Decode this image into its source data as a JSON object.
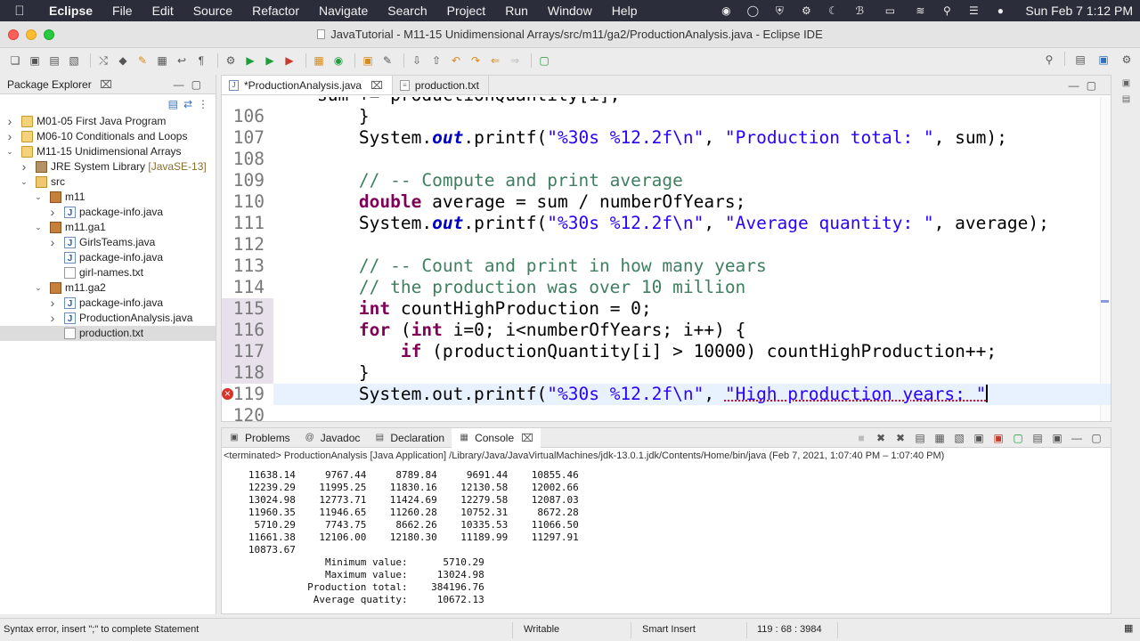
{
  "menubar": {
    "app_name": "Eclipse",
    "items": [
      "File",
      "Edit",
      "Source",
      "Refactor",
      "Navigate",
      "Search",
      "Project",
      "Run",
      "Window",
      "Help"
    ],
    "clock": "Sun Feb 7  1:12 PM",
    "tray_icons": [
      "record-icon",
      "eclipse-icon",
      "shield-icon",
      "settings-icon",
      "moon-icon",
      "bluetooth-icon",
      "battery-icon",
      "wifi-icon",
      "search-icon",
      "control-center-icon",
      "user-icon"
    ]
  },
  "window": {
    "title": "JavaTutorial - M11-15 Unidimensional Arrays/src/m11/ga2/ProductionAnalysis.java - Eclipse IDE"
  },
  "package_explorer": {
    "title": "Package Explorer",
    "tree": [
      {
        "label": "M01-05 First Java Program",
        "deco": "",
        "icon": "project",
        "arrow": ">",
        "depth": 0,
        "selected": false
      },
      {
        "label": "M06-10 Conditionals and Loops",
        "deco": "",
        "icon": "project",
        "arrow": ">",
        "depth": 0,
        "selected": false
      },
      {
        "label": "M11-15 Unidimensional Arrays",
        "deco": "",
        "icon": "project",
        "arrow": "v",
        "depth": 0,
        "selected": false
      },
      {
        "label": "JRE System Library ",
        "deco": "[JavaSE-13]",
        "icon": "library",
        "arrow": ">",
        "depth": 1,
        "selected": false
      },
      {
        "label": "src",
        "deco": "",
        "icon": "folder",
        "arrow": "v",
        "depth": 1,
        "selected": false
      },
      {
        "label": "m11",
        "deco": "",
        "icon": "package",
        "arrow": "v",
        "depth": 2,
        "selected": false
      },
      {
        "label": "package-info.java",
        "deco": "",
        "icon": "java",
        "arrow": ">",
        "depth": 3,
        "selected": false
      },
      {
        "label": "m11.ga1",
        "deco": "",
        "icon": "package",
        "arrow": "v",
        "depth": 2,
        "selected": false
      },
      {
        "label": "GirlsTeams.java",
        "deco": "",
        "icon": "java",
        "arrow": ">",
        "depth": 3,
        "selected": false
      },
      {
        "label": "package-info.java",
        "deco": "",
        "icon": "java",
        "arrow": "",
        "depth": 3,
        "selected": false
      },
      {
        "label": "girl-names.txt",
        "deco": "",
        "icon": "txt",
        "arrow": "",
        "depth": 3,
        "selected": false
      },
      {
        "label": "m11.ga2",
        "deco": "",
        "icon": "package",
        "arrow": "v",
        "depth": 2,
        "selected": false
      },
      {
        "label": "package-info.java",
        "deco": "",
        "icon": "java",
        "arrow": ">",
        "depth": 3,
        "selected": false
      },
      {
        "label": "ProductionAnalysis.java",
        "deco": "",
        "icon": "java",
        "arrow": ">",
        "depth": 3,
        "selected": false
      },
      {
        "label": "production.txt",
        "deco": "",
        "icon": "txt",
        "arrow": "",
        "depth": 3,
        "selected": true
      }
    ]
  },
  "editor": {
    "tabs": [
      {
        "label": "*ProductionAnalysis.java",
        "active": true
      },
      {
        "label": "production.txt",
        "active": false
      }
    ],
    "partial_top_line": "    sum += productionQuantity[i];",
    "lines": [
      {
        "num": "106",
        "hl": false,
        "err": false,
        "cur": false,
        "code": [
          {
            "t": "        }",
            "c": ""
          }
        ]
      },
      {
        "num": "107",
        "hl": false,
        "err": false,
        "cur": false,
        "code": [
          {
            "t": "        System.",
            "c": ""
          },
          {
            "t": "out",
            "c": "fld"
          },
          {
            "t": ".printf(",
            "c": ""
          },
          {
            "t": "\"%30s %12.2f\\n\"",
            "c": "str"
          },
          {
            "t": ", ",
            "c": ""
          },
          {
            "t": "\"Production total: \"",
            "c": "str"
          },
          {
            "t": ", sum);",
            "c": ""
          }
        ]
      },
      {
        "num": "108",
        "hl": false,
        "err": false,
        "cur": false,
        "code": []
      },
      {
        "num": "109",
        "hl": false,
        "err": false,
        "cur": false,
        "code": [
          {
            "t": "        // -- Compute and print average",
            "c": "cm"
          }
        ]
      },
      {
        "num": "110",
        "hl": false,
        "err": false,
        "cur": false,
        "code": [
          {
            "t": "        ",
            "c": ""
          },
          {
            "t": "double",
            "c": "kw"
          },
          {
            "t": " average = sum / numberOfYears;",
            "c": ""
          }
        ]
      },
      {
        "num": "111",
        "hl": false,
        "err": false,
        "cur": false,
        "code": [
          {
            "t": "        System.",
            "c": ""
          },
          {
            "t": "out",
            "c": "fld"
          },
          {
            "t": ".printf(",
            "c": ""
          },
          {
            "t": "\"%30s %12.2f\\n\"",
            "c": "str"
          },
          {
            "t": ", ",
            "c": ""
          },
          {
            "t": "\"Average quantity: \"",
            "c": "str"
          },
          {
            "t": ", average);",
            "c": ""
          }
        ]
      },
      {
        "num": "112",
        "hl": false,
        "err": false,
        "cur": false,
        "code": []
      },
      {
        "num": "113",
        "hl": false,
        "err": false,
        "cur": false,
        "code": [
          {
            "t": "        // -- Count and print in how many years",
            "c": "cm"
          }
        ]
      },
      {
        "num": "114",
        "hl": false,
        "err": false,
        "cur": false,
        "code": [
          {
            "t": "        // the production was over 10 million",
            "c": "cm"
          }
        ]
      },
      {
        "num": "115",
        "hl": true,
        "err": false,
        "cur": false,
        "code": [
          {
            "t": "        ",
            "c": ""
          },
          {
            "t": "int",
            "c": "kw"
          },
          {
            "t": " countHighProduction = 0;",
            "c": ""
          }
        ]
      },
      {
        "num": "116",
        "hl": true,
        "err": false,
        "cur": false,
        "code": [
          {
            "t": "        ",
            "c": ""
          },
          {
            "t": "for",
            "c": "kw"
          },
          {
            "t": " (",
            "c": ""
          },
          {
            "t": "int",
            "c": "kw"
          },
          {
            "t": " i=0; i<numberOfYears; i++) {",
            "c": ""
          }
        ]
      },
      {
        "num": "117",
        "hl": true,
        "err": false,
        "cur": false,
        "code": [
          {
            "t": "            ",
            "c": ""
          },
          {
            "t": "if",
            "c": "kw"
          },
          {
            "t": " (productionQuantity[i] > 10000) countHighProduction++;",
            "c": ""
          }
        ]
      },
      {
        "num": "118",
        "hl": true,
        "err": false,
        "cur": false,
        "code": [
          {
            "t": "        }",
            "c": ""
          }
        ]
      },
      {
        "num": "119",
        "hl": false,
        "err": true,
        "cur": true,
        "code": [
          {
            "t": "        System.out.printf(",
            "c": ""
          },
          {
            "t": "\"%30s %12.2f\\n\"",
            "c": "str"
          },
          {
            "t": ", ",
            "c": ""
          },
          {
            "t": "\"High production years: \"",
            "c": "str errsq"
          }
        ]
      },
      {
        "num": "120",
        "hl": false,
        "err": false,
        "cur": false,
        "code": []
      }
    ]
  },
  "console": {
    "tabs": [
      {
        "label": "Problems",
        "icon": "problems-icon",
        "active": false
      },
      {
        "label": "Javadoc",
        "icon": "at-icon",
        "active": false
      },
      {
        "label": "Declaration",
        "icon": "declaration-icon",
        "active": false
      },
      {
        "label": "Console",
        "icon": "console-icon",
        "active": true
      }
    ],
    "description": "<terminated> ProductionAnalysis [Java Application] /Library/Java/JavaVirtualMachines/jdk-13.0.1.jdk/Contents/Home/bin/java  (Feb 7, 2021, 1:07:40 PM – 1:07:40 PM)",
    "output": [
      "   11638.14     9767.44     8789.84     9691.44    10855.46",
      "   12239.29    11995.25    11830.16    12130.58    12002.66",
      "   13024.98    12773.71    11424.69    12279.58    12087.03",
      "   11960.35    11946.65    11260.28    10752.31     8672.28",
      "    5710.29     7743.75     8662.26    10335.53    11066.50",
      "   11661.38    12106.00    12180.30    11189.99    11297.91",
      "   10873.67",
      "                Minimum value:      5710.29",
      "                Maximum value:     13024.98",
      "             Production total:    384196.76",
      "              Average quatity:     10672.13"
    ]
  },
  "statusbar": {
    "message": "Syntax error, insert \";\" to complete Statement",
    "writable": "Writable",
    "insert_mode": "Smart Insert",
    "position": "119 : 68 : 3984"
  }
}
